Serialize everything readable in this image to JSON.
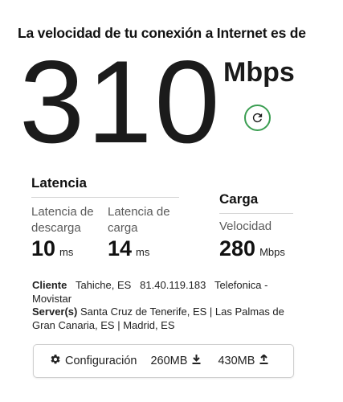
{
  "header": {
    "headline": "La velocidad de tu conexión a Internet es de"
  },
  "speed": {
    "value": "310",
    "unit": "Mbps"
  },
  "refresh": {
    "icon": "refresh-icon",
    "accent_color": "#3b9e52"
  },
  "latency": {
    "title": "Latencia",
    "download": {
      "label": "Latencia de descarga",
      "value": "10",
      "unit": "ms"
    },
    "upload": {
      "label": "Latencia de carga",
      "value": "14",
      "unit": "ms"
    }
  },
  "upload": {
    "title": "Carga",
    "speed": {
      "label": "Velocidad",
      "value": "280",
      "unit": "Mbps"
    }
  },
  "client": {
    "label": "Cliente",
    "location": "Tahiche, ES",
    "ip": "81.40.119.183",
    "isp": "Telefonica - Movistar"
  },
  "servers": {
    "label": "Server(s)",
    "list": "Santa Cruz de Tenerife, ES | Las Palmas de Gran Canaria, ES | Madrid, ES"
  },
  "footer": {
    "settings_label": "Configuración",
    "settings_icon": "gear-icon",
    "downloaded": "260MB",
    "download_icon": "download-icon",
    "uploaded": "430MB",
    "upload_icon": "upload-icon"
  }
}
